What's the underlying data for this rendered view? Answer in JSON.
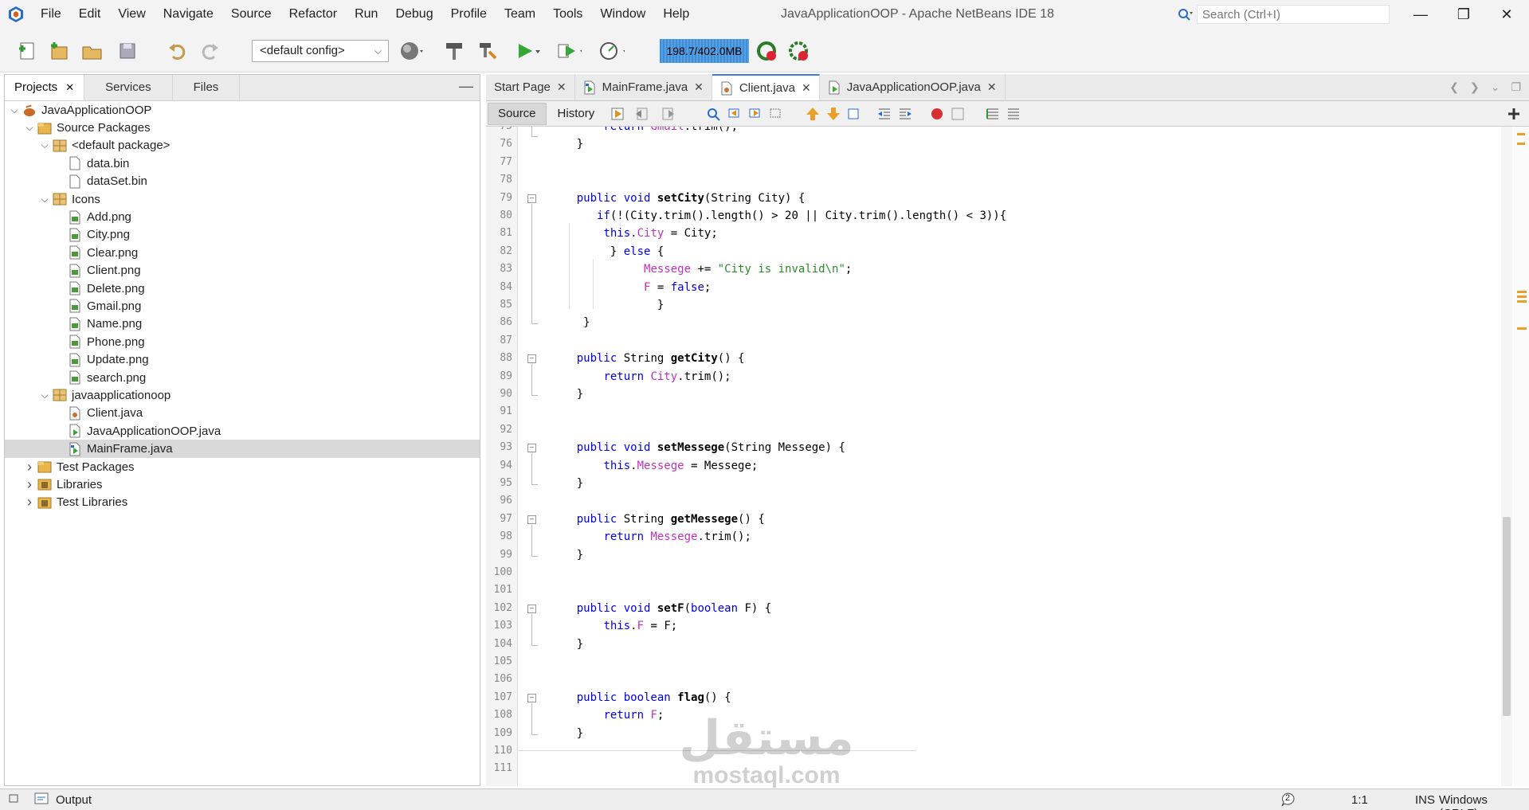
{
  "window": {
    "title": "JavaApplicationOOP - Apache NetBeans IDE 18",
    "search_placeholder": "Search (Ctrl+I)"
  },
  "menu": [
    "File",
    "Edit",
    "View",
    "Navigate",
    "Source",
    "Refactor",
    "Run",
    "Debug",
    "Profile",
    "Team",
    "Tools",
    "Window",
    "Help"
  ],
  "toolbar": {
    "config_value": "<default config>",
    "memory": "198.7/402.0MB"
  },
  "left_panel": {
    "tabs": [
      "Projects",
      "Services",
      "Files"
    ],
    "active_tab": "Projects",
    "tree": [
      {
        "label": "JavaApplicationOOP",
        "depth": 0,
        "toggle": "expanded",
        "icon": "project-icon"
      },
      {
        "label": "Source Packages",
        "depth": 1,
        "toggle": "expanded",
        "icon": "source-packages-icon"
      },
      {
        "label": "<default package>",
        "depth": 2,
        "toggle": "expanded",
        "icon": "package-icon"
      },
      {
        "label": "data.bin",
        "depth": 3,
        "toggle": "none",
        "icon": "file-icon"
      },
      {
        "label": "dataSet.bin",
        "depth": 3,
        "toggle": "none",
        "icon": "file-icon"
      },
      {
        "label": "Icons",
        "depth": 2,
        "toggle": "expanded",
        "icon": "package-icon"
      },
      {
        "label": "Add.png",
        "depth": 3,
        "toggle": "none",
        "icon": "image-file-icon"
      },
      {
        "label": "City.png",
        "depth": 3,
        "toggle": "none",
        "icon": "image-file-icon"
      },
      {
        "label": "Clear.png",
        "depth": 3,
        "toggle": "none",
        "icon": "image-file-icon"
      },
      {
        "label": "Client.png",
        "depth": 3,
        "toggle": "none",
        "icon": "image-file-icon"
      },
      {
        "label": "Delete.png",
        "depth": 3,
        "toggle": "none",
        "icon": "image-file-icon"
      },
      {
        "label": "Gmail.png",
        "depth": 3,
        "toggle": "none",
        "icon": "image-file-icon"
      },
      {
        "label": "Name.png",
        "depth": 3,
        "toggle": "none",
        "icon": "image-file-icon"
      },
      {
        "label": "Phone.png",
        "depth": 3,
        "toggle": "none",
        "icon": "image-file-icon"
      },
      {
        "label": "Update.png",
        "depth": 3,
        "toggle": "none",
        "icon": "image-file-icon"
      },
      {
        "label": "search.png",
        "depth": 3,
        "toggle": "none",
        "icon": "image-file-icon"
      },
      {
        "label": "javaapplicationoop",
        "depth": 2,
        "toggle": "expanded",
        "icon": "package-icon"
      },
      {
        "label": "Client.java",
        "depth": 3,
        "toggle": "none",
        "icon": "java-class-icon"
      },
      {
        "label": "JavaApplicationOOP.java",
        "depth": 3,
        "toggle": "none",
        "icon": "java-main-icon"
      },
      {
        "label": "MainFrame.java",
        "depth": 3,
        "toggle": "none",
        "icon": "java-form-icon",
        "selected": true
      },
      {
        "label": "Test Packages",
        "depth": 1,
        "toggle": "collapsed",
        "icon": "test-packages-icon"
      },
      {
        "label": "Libraries",
        "depth": 1,
        "toggle": "collapsed",
        "icon": "libraries-icon"
      },
      {
        "label": "Test Libraries",
        "depth": 1,
        "toggle": "collapsed",
        "icon": "libraries-icon"
      }
    ]
  },
  "editor": {
    "tabs": [
      {
        "label": "Start Page",
        "active": false,
        "icon": ""
      },
      {
        "label": "MainFrame.java",
        "active": false,
        "icon": "java-form-icon"
      },
      {
        "label": "Client.java",
        "active": true,
        "icon": "java-class-icon"
      },
      {
        "label": "JavaApplicationOOP.java",
        "active": false,
        "icon": "java-main-icon"
      }
    ],
    "view_buttons": [
      "Source",
      "History"
    ],
    "first_line": 75,
    "lines": [
      [
        [
          "        return ",
          "kw"
        ],
        [
          "Gmail",
          "fd"
        ],
        [
          ".trim();",
          ""
        ]
      ],
      [
        [
          "    }",
          ""
        ]
      ],
      [],
      [],
      [
        [
          "    ",
          ""
        ],
        [
          "public void ",
          "kw"
        ],
        [
          "setCity",
          "b"
        ],
        [
          "(String City) {",
          ""
        ]
      ],
      [
        [
          "       ",
          ""
        ],
        [
          "if",
          "kw"
        ],
        [
          "(!(City.trim().length() > 20 || City.trim().length() < 3)){",
          ""
        ]
      ],
      [
        [
          "        ",
          ""
        ],
        [
          "this",
          "kw"
        ],
        [
          ".",
          ""
        ],
        [
          "City",
          "fd"
        ],
        [
          " = City;",
          ""
        ]
      ],
      [
        [
          "         } ",
          ""
        ],
        [
          "else",
          "kw"
        ],
        [
          " {",
          ""
        ]
      ],
      [
        [
          "              ",
          ""
        ],
        [
          "Messege",
          "fd"
        ],
        [
          " += ",
          ""
        ],
        [
          "\"City is invalid\\n\"",
          "str"
        ],
        [
          ";",
          ""
        ]
      ],
      [
        [
          "              ",
          ""
        ],
        [
          "F",
          "fd"
        ],
        [
          " = ",
          ""
        ],
        [
          "false",
          "kw"
        ],
        [
          ";",
          ""
        ]
      ],
      [
        [
          "                }",
          ""
        ]
      ],
      [
        [
          "     }",
          ""
        ]
      ],
      [],
      [
        [
          "    ",
          ""
        ],
        [
          "public ",
          "kw"
        ],
        [
          "String ",
          ""
        ],
        [
          "getCity",
          "b"
        ],
        [
          "() {",
          ""
        ]
      ],
      [
        [
          "        ",
          ""
        ],
        [
          "return ",
          "kw"
        ],
        [
          "City",
          "fd"
        ],
        [
          ".trim();",
          ""
        ]
      ],
      [
        [
          "    }",
          ""
        ]
      ],
      [],
      [],
      [
        [
          "    ",
          ""
        ],
        [
          "public void ",
          "kw"
        ],
        [
          "setMessege",
          "b"
        ],
        [
          "(String Messege) {",
          ""
        ]
      ],
      [
        [
          "        ",
          ""
        ],
        [
          "this",
          "kw"
        ],
        [
          ".",
          ""
        ],
        [
          "Messege",
          "fd"
        ],
        [
          " = Messege;",
          ""
        ]
      ],
      [
        [
          "    }",
          ""
        ]
      ],
      [],
      [
        [
          "    ",
          ""
        ],
        [
          "public ",
          "kw"
        ],
        [
          "String ",
          ""
        ],
        [
          "getMessege",
          "b"
        ],
        [
          "() {",
          ""
        ]
      ],
      [
        [
          "        ",
          ""
        ],
        [
          "return ",
          "kw"
        ],
        [
          "Messege",
          "fd"
        ],
        [
          ".trim();",
          ""
        ]
      ],
      [
        [
          "    }",
          ""
        ]
      ],
      [],
      [],
      [
        [
          "    ",
          ""
        ],
        [
          "public void ",
          "kw"
        ],
        [
          "setF",
          "b"
        ],
        [
          "(",
          ""
        ],
        [
          "boolean ",
          "kw"
        ],
        [
          "F) {",
          ""
        ]
      ],
      [
        [
          "        ",
          ""
        ],
        [
          "this",
          "kw"
        ],
        [
          ".",
          ""
        ],
        [
          "F",
          "fd"
        ],
        [
          " = F;",
          ""
        ]
      ],
      [
        [
          "    }",
          ""
        ]
      ],
      [],
      [],
      [
        [
          "    ",
          ""
        ],
        [
          "public boolean ",
          "kw"
        ],
        [
          "flag",
          "b"
        ],
        [
          "() {",
          ""
        ]
      ],
      [
        [
          "        ",
          ""
        ],
        [
          "return ",
          "kw"
        ],
        [
          "F",
          "fd"
        ],
        [
          ";",
          ""
        ]
      ],
      [
        [
          "    }",
          ""
        ]
      ],
      [],
      []
    ]
  },
  "status": {
    "output_label": "Output",
    "notifications": "2",
    "position": "1:1",
    "insert_mode": "INS",
    "line_endings": "Windows (CRLF)"
  },
  "watermark": {
    "arabic": "مستقل",
    "latin": "mostaql.com"
  }
}
